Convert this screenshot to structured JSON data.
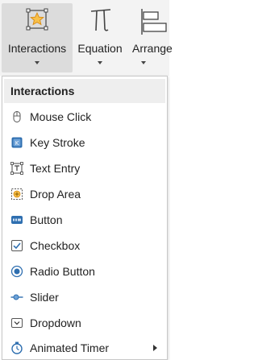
{
  "ribbon": {
    "buttons": [
      {
        "label": "Interactions",
        "icon": "star-in-box-icon",
        "active": true
      },
      {
        "label": "Equation",
        "icon": "pi-icon"
      },
      {
        "label": "Arrange",
        "icon": "align-icon"
      }
    ]
  },
  "menu": {
    "header": "Interactions",
    "items": [
      {
        "label": "Mouse Click",
        "icon": "mouse-icon"
      },
      {
        "label": "Key Stroke",
        "icon": "key-icon"
      },
      {
        "label": "Text Entry",
        "icon": "text-entry-icon"
      },
      {
        "label": "Drop Area",
        "icon": "drop-area-icon"
      },
      {
        "label": "Button",
        "icon": "button-icon"
      },
      {
        "label": "Checkbox",
        "icon": "checkbox-icon"
      },
      {
        "label": "Radio Button",
        "icon": "radio-icon"
      },
      {
        "label": "Slider",
        "icon": "slider-icon"
      },
      {
        "label": "Dropdown",
        "icon": "dropdown-icon"
      },
      {
        "label": "Animated Timer",
        "icon": "timer-icon",
        "has_submenu": true
      }
    ]
  },
  "colors": {
    "ribbon_bg": "#f3f3f3",
    "active_button_bg": "#dcdcdc",
    "icon_blue": "#2f6fb0",
    "star_orange": "#f0a830",
    "header_bg": "#eeeeee"
  }
}
